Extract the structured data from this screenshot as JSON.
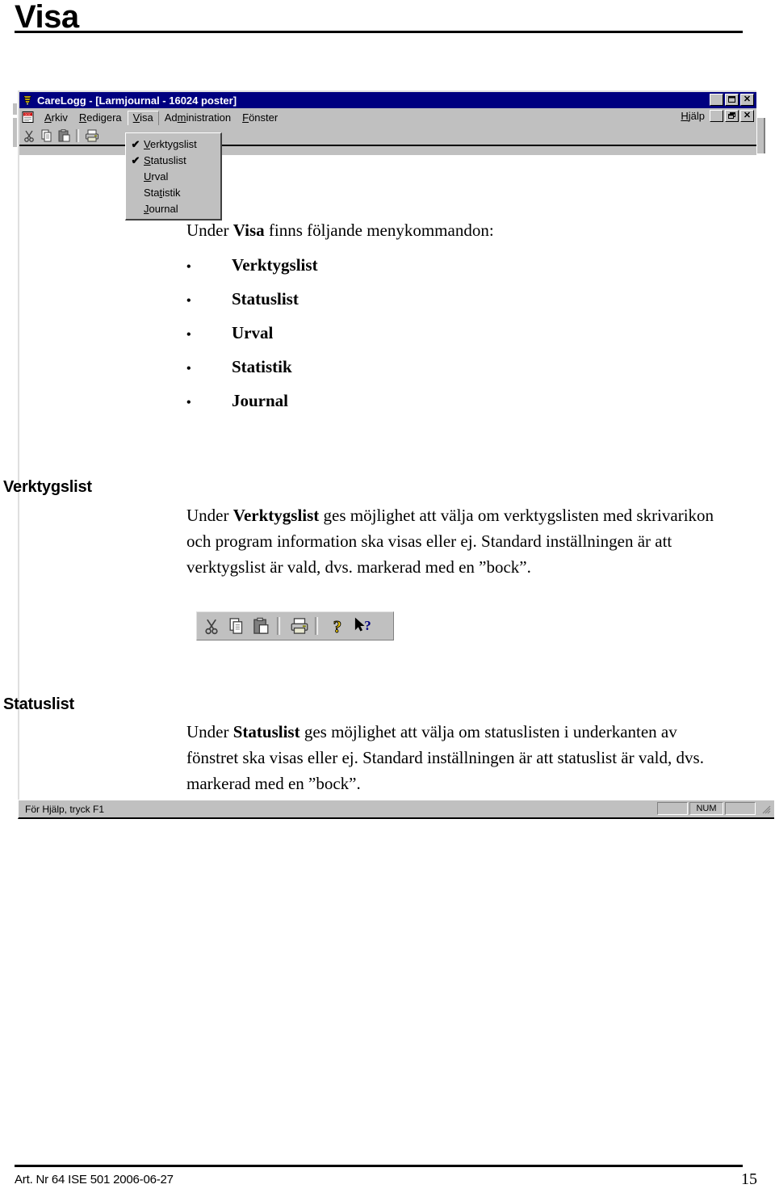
{
  "page": {
    "title": "Visa",
    "footer_left": "Art. Nr 64 ISE 501  2006-06-27",
    "footer_page": "15"
  },
  "app_window": {
    "icon": "carelogg-app-icon",
    "title": "CareLogg - [Larmjournal - 16024 poster]",
    "titlebar_buttons": [
      {
        "name": "minimize",
        "glyph": "_"
      },
      {
        "name": "maximize",
        "glyph": "❐"
      },
      {
        "name": "close",
        "glyph": "✕"
      }
    ],
    "mdi_buttons": [
      {
        "name": "mdi-minimize",
        "glyph": "_"
      },
      {
        "name": "mdi-restore",
        "glyph": "❐"
      },
      {
        "name": "mdi-close",
        "glyph": "✕"
      }
    ],
    "document_icon": "document-icon",
    "menubar": [
      {
        "label": "Arkiv",
        "mnemonic": "A",
        "active": false
      },
      {
        "label": "Redigera",
        "mnemonic": "R",
        "active": false
      },
      {
        "label": "Visa",
        "mnemonic": "V",
        "active": true
      },
      {
        "label": "Administration",
        "mnemonic": "m",
        "active": false
      },
      {
        "label": "Fönster",
        "mnemonic": "F",
        "active": false
      }
    ],
    "help_menu": {
      "label": "Hjälp",
      "mnemonic": "H"
    },
    "toolbar_icons": [
      "cut-icon",
      "copy-icon",
      "paste-icon",
      "separator",
      "print-icon"
    ],
    "dropdown": {
      "owner": "Visa",
      "items": [
        {
          "label": "Verktygslist",
          "mnemonic": "V",
          "checked": true,
          "check_glyph": "✔"
        },
        {
          "label": "Statuslist",
          "mnemonic": "S",
          "checked": true,
          "check_glyph": "✔"
        },
        {
          "label": "Urval",
          "mnemonic": "U",
          "checked": false,
          "check_glyph": ""
        },
        {
          "label": "Statistik",
          "mnemonic": "t",
          "checked": false,
          "check_glyph": ""
        },
        {
          "label": "Journal",
          "mnemonic": "J",
          "checked": false,
          "check_glyph": ""
        }
      ]
    },
    "statusbar": {
      "text": "För Hjälp, tryck F1",
      "panes": [
        "",
        "NUM",
        ""
      ],
      "grip": "resize-grip"
    }
  },
  "body": {
    "intro_prefix": "Under ",
    "intro_bold": "Visa",
    "intro_suffix": " finns följande menykommandon:",
    "bullets": [
      "Verktygslist",
      "Statuslist",
      "Urval",
      "Statistik",
      "Journal"
    ],
    "bullet_glyph": "•"
  },
  "sections": [
    {
      "heading": "Verktygslist",
      "para_prefix": "Under ",
      "para_bold": "Verktygslist",
      "para_suffix": " ges möjlighet att välja om verktygslisten med skrivarikon och program information ska visas eller ej. Standard inställningen är att verktygslist är vald, dvs. markerad med en ”bock”."
    },
    {
      "heading": "Statuslist",
      "para_prefix": "Under ",
      "para_bold": "Statuslist",
      "para_suffix": " ges möjlighet att välja om statuslisten i underkanten av fönstret ska visas eller ej. Standard inställningen är att statuslist är vald, dvs. markerad med en ”bock”."
    }
  ],
  "toolbar_figure": {
    "icons": [
      "cut-icon",
      "copy-icon",
      "paste-icon",
      "separator",
      "print-icon",
      "separator",
      "help-icon",
      "context-help-icon"
    ]
  },
  "colors": {
    "titlebar": "#000080",
    "chrome": "#c0c0c0",
    "text": "#000000",
    "page_bg": "#ffffff"
  }
}
